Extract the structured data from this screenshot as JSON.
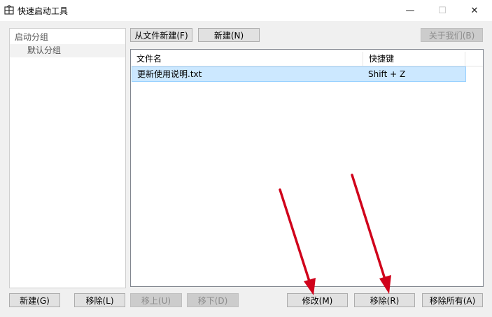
{
  "window": {
    "title": "快速启动工具",
    "minimize_glyph": "—",
    "maximize_glyph": "☐",
    "close_glyph": "✕"
  },
  "tree": {
    "root_label": "启动分组",
    "child_label": "默认分组"
  },
  "toolbar": {
    "new_from_file": "从文件新建(F)",
    "new": "新建(N)",
    "about": "关于我们(B)"
  },
  "table": {
    "columns": [
      "文件名",
      "快捷键"
    ],
    "rows": [
      {
        "name": "更新使用说明.txt",
        "shortcut": "Shift + Z"
      }
    ]
  },
  "bottom_left": {
    "new": "新建(G)",
    "remove": "移除(L)",
    "move_up": "移上(U)",
    "move_down": "移下(D)"
  },
  "bottom_right": {
    "modify": "修改(M)",
    "remove": "移除(R)",
    "remove_all": "移除所有(A)"
  },
  "colors": {
    "selection": "#cce8ff",
    "annotation_arrow": "#d0021b"
  }
}
